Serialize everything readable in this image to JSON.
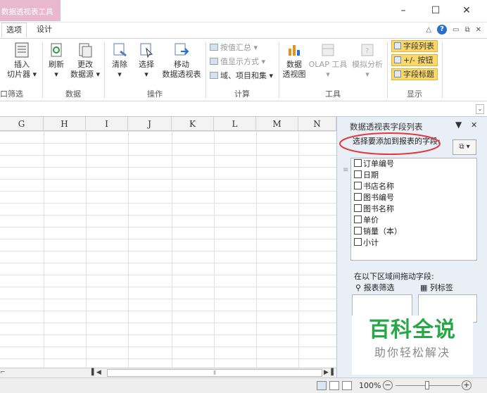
{
  "title_bar": {
    "context_tab_label": "数据透视表工具",
    "minimize": "–",
    "maximize": "☐",
    "close": "✕"
  },
  "tabs": {
    "options": "选项",
    "design": "设计"
  },
  "ribbon": {
    "slicer": {
      "line1": "插入",
      "line2": "切片器 ▾"
    },
    "refresh": {
      "line1": "刷新",
      "line2": "▾"
    },
    "change_source": {
      "line1": "更改",
      "line2": "数据源 ▾"
    },
    "clear": {
      "line1": "清除",
      "line2": "▾"
    },
    "select": {
      "line1": "选择",
      "line2": "▾"
    },
    "move": {
      "line1": "移动",
      "line2": "数据透视表"
    },
    "summarize_by": "按值汇总 ▾",
    "show_values_as": "值显示方式 ▾",
    "fields_items_sets": "域、项目和集 ▾",
    "pivot_chart": {
      "line1": "数据",
      "line2": "透视图"
    },
    "olap_tools": {
      "line1": "OLAP 工具",
      "line2": "▾"
    },
    "what_if": {
      "line1": "模拟分析",
      "line2": "▾"
    },
    "field_list": "字段列表",
    "plus_minus_buttons": "+/- 按钮",
    "field_headers": "字段标题",
    "groups": {
      "filter": "口筛选",
      "data": "数据",
      "actions": "操作",
      "calculations": "计算",
      "tools": "工具",
      "show": "显示"
    }
  },
  "grid": {
    "columns": [
      "G",
      "H",
      "I",
      "J",
      "K",
      "L",
      "M",
      "N"
    ]
  },
  "field_pane": {
    "title": "数据透视表字段列表",
    "prompt": "选择要添加到报表的字段:",
    "fields": [
      "订单编号",
      "日期",
      "书店名称",
      "图书编号",
      "图书名称",
      "单价",
      "销量（本）",
      "小计"
    ],
    "drag_prompt": "在以下区域间拖动字段:",
    "report_filter": "报表筛选",
    "column_labels": "列标签"
  },
  "status_bar": {
    "zoom": "100%"
  },
  "watermark": {
    "title": "百科全说",
    "subtitle": "助你轻松解决"
  },
  "colors": {
    "context_tab": "#e8b8cf",
    "highlight_button": "#fbd86a",
    "pane_bg": "#e9eff7",
    "annotation_circle": "#e03a3a",
    "watermark_green": "#27a745"
  }
}
